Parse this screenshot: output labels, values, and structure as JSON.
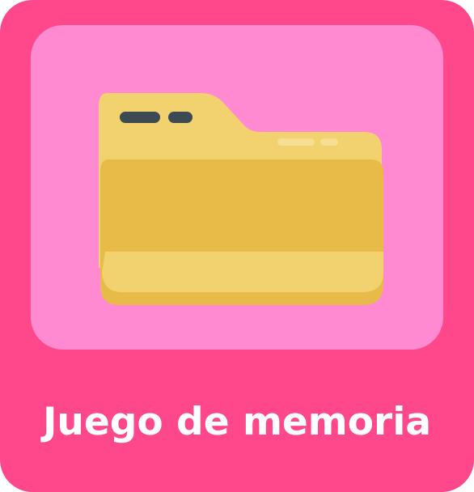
{
  "tile": {
    "label": "Juego de memoria",
    "icon": "folder-brain-icon"
  },
  "colors": {
    "tile_background": "#FF488C",
    "panel_background": "#FF8AD2",
    "folder": "#F2D26E",
    "folder_shadow": "#E8BA48",
    "brain": "#E08C8F",
    "brain_dark": "#C9787C",
    "label_text": "#FFFFFF"
  }
}
